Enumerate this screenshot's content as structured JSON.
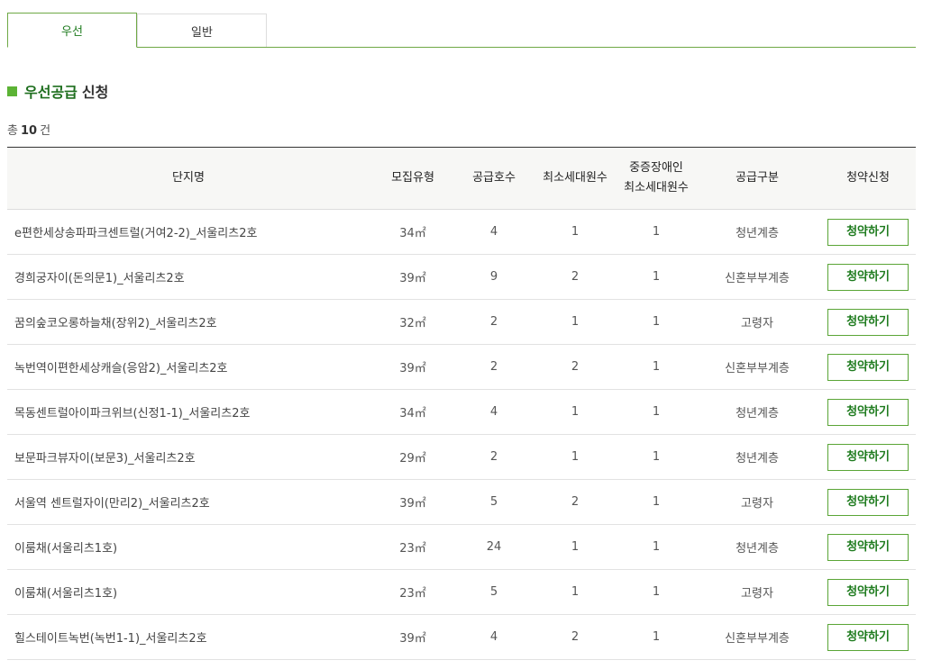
{
  "tabs": [
    {
      "label": "우선",
      "active": true
    },
    {
      "label": "일반",
      "active": false
    }
  ],
  "section": {
    "title_green": "우선공급",
    "title_rest": "신청"
  },
  "count": {
    "prefix": "총",
    "value": "10",
    "suffix": "건"
  },
  "table": {
    "headers": {
      "name": "단지명",
      "type": "모집유형",
      "units": "공급호수",
      "min_households": "최소세대원수",
      "disabled_line1": "중증장애인",
      "disabled_line2": "최소세대원수",
      "category": "공급구분",
      "apply": "청약신청"
    },
    "rows": [
      {
        "name": "e편한세상송파파크센트럴(거여2-2)_서울리츠2호",
        "type": "34㎡",
        "units": "4",
        "min": "1",
        "disabled_min": "1",
        "category": "청년계층",
        "button": "청약하기"
      },
      {
        "name": "경희궁자이(돈의문1)_서울리츠2호",
        "type": "39㎡",
        "units": "9",
        "min": "2",
        "disabled_min": "1",
        "category": "신혼부부계층",
        "button": "청약하기"
      },
      {
        "name": "꿈의숲코오롱하늘채(장위2)_서울리츠2호",
        "type": "32㎡",
        "units": "2",
        "min": "1",
        "disabled_min": "1",
        "category": "고령자",
        "button": "청약하기"
      },
      {
        "name": "녹번역이편한세상캐슬(응암2)_서울리츠2호",
        "type": "39㎡",
        "units": "2",
        "min": "2",
        "disabled_min": "1",
        "category": "신혼부부계층",
        "button": "청약하기"
      },
      {
        "name": "목동센트럴아이파크위브(신정1-1)_서울리츠2호",
        "type": "34㎡",
        "units": "4",
        "min": "1",
        "disabled_min": "1",
        "category": "청년계층",
        "button": "청약하기"
      },
      {
        "name": "보문파크뷰자이(보문3)_서울리츠2호",
        "type": "29㎡",
        "units": "2",
        "min": "1",
        "disabled_min": "1",
        "category": "청년계층",
        "button": "청약하기"
      },
      {
        "name": "서울역 센트럴자이(만리2)_서울리츠2호",
        "type": "39㎡",
        "units": "5",
        "min": "2",
        "disabled_min": "1",
        "category": "고령자",
        "button": "청약하기"
      },
      {
        "name": "이룸채(서울리츠1호)",
        "type": "23㎡",
        "units": "24",
        "min": "1",
        "disabled_min": "1",
        "category": "청년계층",
        "button": "청약하기"
      },
      {
        "name": "이룸채(서울리츠1호)",
        "type": "23㎡",
        "units": "5",
        "min": "1",
        "disabled_min": "1",
        "category": "고령자",
        "button": "청약하기"
      },
      {
        "name": "힐스테이트녹번(녹번1-1)_서울리츠2호",
        "type": "39㎡",
        "units": "4",
        "min": "2",
        "disabled_min": "1",
        "category": "신혼부부계층",
        "button": "청약하기"
      }
    ]
  },
  "colors": {
    "accent_green": "#5cb335",
    "title_green": "#1e6e1e",
    "tab_border": "#6fa946"
  }
}
